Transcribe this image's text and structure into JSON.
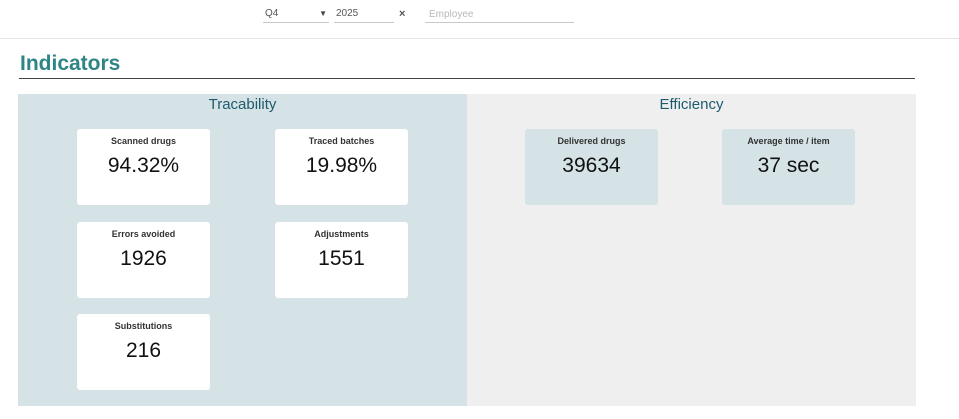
{
  "filters": {
    "quarter": "Q4",
    "year": "2025",
    "clear_icon": "×",
    "employee_placeholder": "Employee"
  },
  "page_title": "Indicators",
  "panels": {
    "traceability": {
      "title": "Tracability",
      "cards": [
        {
          "label": "Scanned drugs",
          "value": "94.32%"
        },
        {
          "label": "Traced batches",
          "value": "19.98%"
        },
        {
          "label": "Errors avoided",
          "value": "1926"
        },
        {
          "label": "Adjustments",
          "value": "1551"
        },
        {
          "label": "Substitutions",
          "value": "216"
        }
      ]
    },
    "efficiency": {
      "title": "Efficiency",
      "cards": [
        {
          "label": "Delivered drugs",
          "value": "39634"
        },
        {
          "label": "Average time / item",
          "value": "37 sec"
        }
      ]
    }
  },
  "colors": {
    "title": "#2f8585",
    "trace_panel": "#d5e2e6",
    "eff_panel": "#efefef",
    "panel_title": "#1e5a6e"
  }
}
